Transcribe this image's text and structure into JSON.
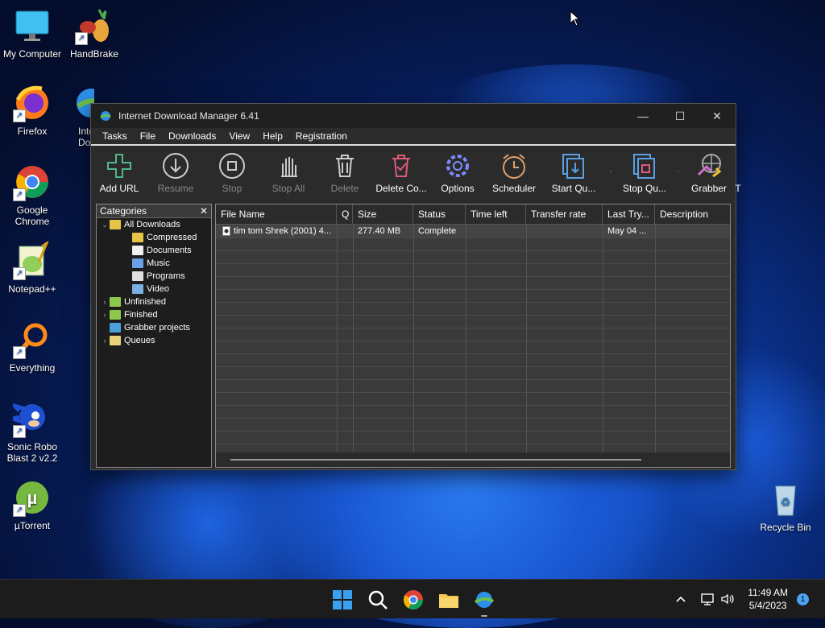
{
  "desktop": {
    "icons": [
      {
        "label": "My Computer"
      },
      {
        "label": "HandBrake"
      },
      {
        "label": "Firefox"
      },
      {
        "label": "Inte Dov"
      },
      {
        "label": "Google Chrome"
      },
      {
        "label": "Notepad++"
      },
      {
        "label": "Everything"
      },
      {
        "label": "Sonic Robo Blast 2 v2.2"
      },
      {
        "label": "µTorrent"
      },
      {
        "label": "Recycle Bin"
      }
    ]
  },
  "window": {
    "title": "Internet Download Manager 6.41",
    "controls": {
      "minimize": "—",
      "maximize": "☐",
      "close": "✕"
    }
  },
  "menu": [
    "Tasks",
    "File",
    "Downloads",
    "View",
    "Help",
    "Registration"
  ],
  "toolbar": {
    "add_url": "Add URL",
    "resume": "Resume",
    "stop": "Stop",
    "stop_all": "Stop All",
    "delete": "Delete",
    "delete_completed": "Delete Co...",
    "options": "Options",
    "scheduler": "Scheduler",
    "start_queue": "Start Qu...",
    "stop_queue": "Stop Qu...",
    "grabber": "Grabber",
    "more": "T"
  },
  "categories": {
    "header": "Categories",
    "close": "✕",
    "tree": [
      {
        "label": "All Downloads",
        "toggle": "⌄",
        "color": "#e8c34a"
      },
      {
        "label": "Compressed",
        "color": "#e8c34a"
      },
      {
        "label": "Documents",
        "color": "#f0f0f0"
      },
      {
        "label": "Music",
        "color": "#6aa0e8"
      },
      {
        "label": "Programs",
        "color": "#e0e0e0"
      },
      {
        "label": "Video",
        "color": "#7ab0e0"
      },
      {
        "label": "Unfinished",
        "toggle": "›",
        "color": "#8cc84b"
      },
      {
        "label": "Finished",
        "toggle": "›",
        "color": "#8cc84b"
      },
      {
        "label": "Grabber projects",
        "color": "#4aa0d8"
      },
      {
        "label": "Queues",
        "toggle": "›",
        "color": "#e8d27a"
      }
    ]
  },
  "downloads": {
    "columns": [
      "File Name",
      "Q",
      "Size",
      "Status",
      "Time left",
      "Transfer rate",
      "Last Try...",
      "Description"
    ],
    "rows": [
      {
        "file_name": "tim tom Shrek (2001) 4...",
        "q": "",
        "size": "277.40  MB",
        "status": "Complete",
        "time_left": "",
        "transfer_rate": "",
        "last_try": "May 04 ...",
        "description": ""
      }
    ]
  },
  "taskbar": {
    "time": "11:49 AM",
    "date": "5/4/2023",
    "notifications": "1"
  }
}
